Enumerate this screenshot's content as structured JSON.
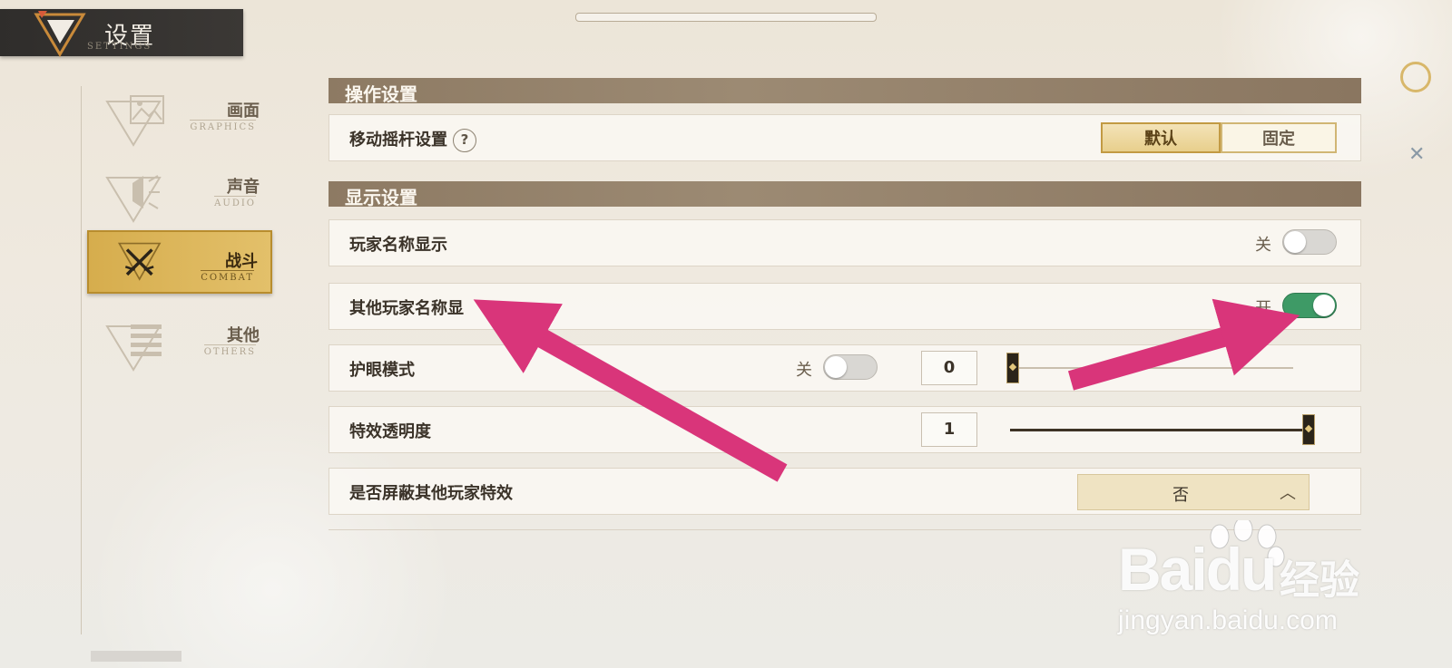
{
  "header": {
    "title": "设置",
    "subtitle": "SETTINGS"
  },
  "sidebar": {
    "items": [
      {
        "label": "画面",
        "sub": "GRAPHICS",
        "icon": "image-icon",
        "active": false
      },
      {
        "label": "声音",
        "sub": "AUDIO",
        "icon": "speaker-icon",
        "active": false
      },
      {
        "label": "战斗",
        "sub": "COMBAT",
        "icon": "swords-icon",
        "active": true
      },
      {
        "label": "其他",
        "sub": "OTHERS",
        "icon": "list-icon",
        "active": false
      }
    ]
  },
  "sections": {
    "operation": {
      "title": "操作设置"
    },
    "display": {
      "title": "显示设置"
    }
  },
  "rows": {
    "joystick": {
      "label": "移动摇杆设置",
      "help": "?",
      "option_default": "默认",
      "option_fixed": "固定",
      "selected": "默认"
    },
    "player_name": {
      "label": "玩家名称显示",
      "toggle_label": "关",
      "state": "off"
    },
    "other_player_name": {
      "label": "其他玩家名称显",
      "toggle_label": "开",
      "state": "on"
    },
    "eye_care": {
      "label": "护眼模式",
      "toggle_label": "关",
      "state": "off",
      "value": "0",
      "slider": 0
    },
    "effect_opacity": {
      "label": "特效透明度",
      "value": "1",
      "slider": 1
    },
    "block_effects": {
      "label": "是否屏蔽其他玩家特效",
      "value": "否"
    }
  },
  "watermark": {
    "brand": "Bai",
    "brand2": "du",
    "cn": "经验",
    "url": "jingyan.baidu.com"
  },
  "colors": {
    "accent_gold": "#d6ad4d",
    "toggle_on": "#3e9a66",
    "arrow": "#d9357a",
    "section_bg": "#8d7a63"
  }
}
